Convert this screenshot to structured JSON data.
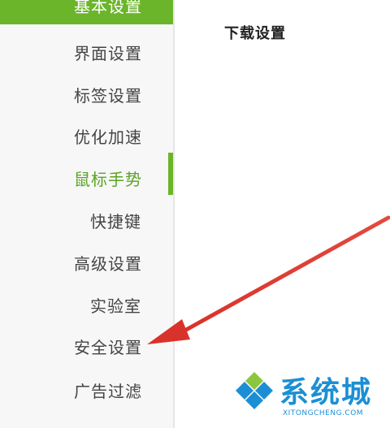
{
  "sidebar": {
    "active_item": "基本设置",
    "items": [
      {
        "label": "界面设置"
      },
      {
        "label": "标签设置"
      },
      {
        "label": "优化加速"
      },
      {
        "label": "鼠标手势"
      },
      {
        "label": "快捷键"
      },
      {
        "label": "高级设置"
      },
      {
        "label": "实验室"
      },
      {
        "label": "安全设置"
      },
      {
        "label": "广告过滤"
      }
    ]
  },
  "content": {
    "section_title": "下载设置"
  },
  "watermark": {
    "brand": "系统城",
    "url": "XITONGCHENG.COM"
  },
  "colors": {
    "accent_green": "#6bb52a",
    "arrow_red": "#d9322b",
    "watermark_blue": "#1c8fd4"
  }
}
